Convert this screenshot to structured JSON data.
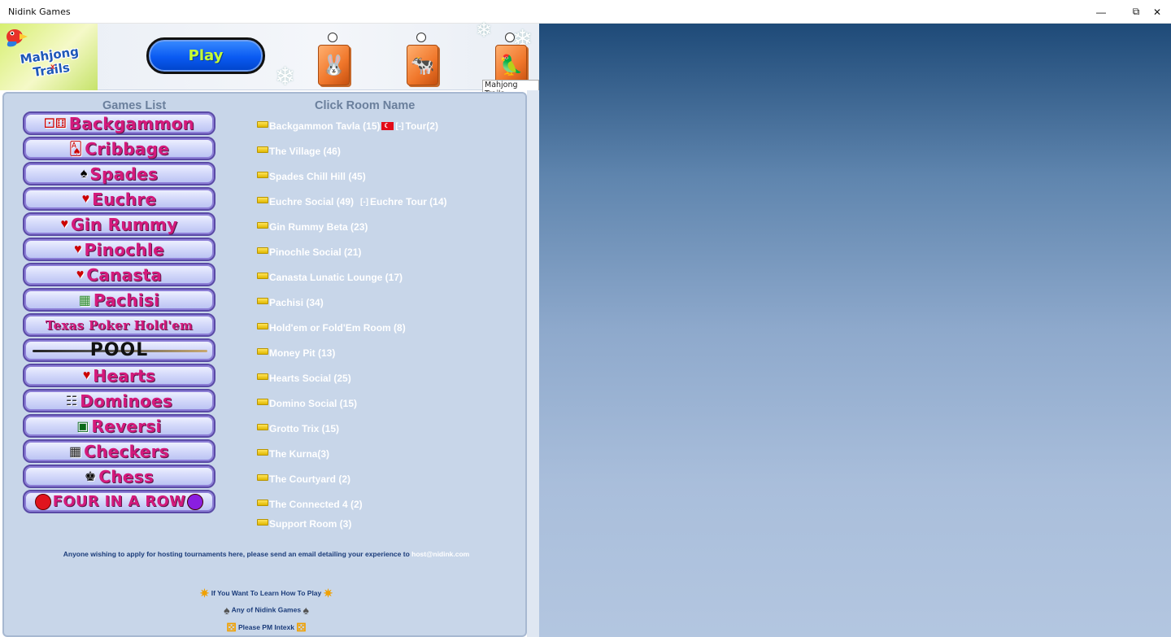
{
  "window": {
    "title": "Nidink Games",
    "minimize_glyph": "—",
    "maximize_glyph": "⧉",
    "close_glyph": "✕"
  },
  "banner": {
    "logo_text": "Mahjong Trails",
    "logo_mark": "x",
    "play_label": "Play",
    "snow_glyph": "❄",
    "tiles": [
      {
        "icon": "rabbit-icon",
        "glyph": "🐰"
      },
      {
        "icon": "cow-icon",
        "glyph": "🐄"
      },
      {
        "icon": "parrot-icon",
        "glyph": "🦜"
      }
    ],
    "tile_caption": "Mahjong Trails"
  },
  "panel": {
    "games_header": "Games List",
    "rooms_header": "Click Room Name",
    "games": [
      {
        "label": "Backgammon",
        "icon": "dice-icon",
        "glyph": "⚀⚅"
      },
      {
        "label": "Cribbage",
        "icon": "cards-icon",
        "glyph": "🂡"
      },
      {
        "label": "Spades",
        "icon": "cards-icon",
        "glyph": "♠"
      },
      {
        "label": "Euchre",
        "icon": "cards-icon",
        "glyph": "♥"
      },
      {
        "label": "Gin Rummy",
        "icon": "cards-icon",
        "glyph": "♥"
      },
      {
        "label": "Pinochle",
        "icon": "cards-icon",
        "glyph": "♥"
      },
      {
        "label": "Canasta",
        "icon": "cards-icon",
        "glyph": "♥"
      },
      {
        "label": "Pachisi",
        "icon": "board-icon",
        "glyph": "▦"
      },
      {
        "label": "Texas Poker Hold'em",
        "icon": "cards-icon",
        "glyph": ""
      },
      {
        "label": "POOL",
        "icon": "cue-icon",
        "glyph": ""
      },
      {
        "label": "Hearts",
        "icon": "cards-icon",
        "glyph": "♥"
      },
      {
        "label": "Dominoes",
        "icon": "domino-icon",
        "glyph": "☷"
      },
      {
        "label": "Reversi",
        "icon": "reversi-icon",
        "glyph": "▣"
      },
      {
        "label": "Checkers",
        "icon": "checkerboard-icon",
        "glyph": "▦"
      },
      {
        "label": "Chess",
        "icon": "chess-icon",
        "glyph": "♚"
      },
      {
        "label": "FOUR IN A ROW",
        "icon": "disc-icon",
        "glyph": ""
      }
    ],
    "rooms": [
      {
        "label": "Backgammon Tavla (15)",
        "extra": "Tour(2)"
      },
      {
        "label": "The Village (46)"
      },
      {
        "label": "Spades Chill Hill (45)"
      },
      {
        "label": "Euchre Social (49)",
        "extra": "Euchre Tour (14)"
      },
      {
        "label": "Gin Rummy Beta (23)"
      },
      {
        "label": "Pinochle Social (21)"
      },
      {
        "label": "Canasta Lunatic Lounge (17)"
      },
      {
        "label": "Pachisi (34)"
      },
      {
        "label": "Hold'em or Fold'Em Room (8)"
      },
      {
        "label": "Money Pit (13)"
      },
      {
        "label": "Hearts Social (25)"
      },
      {
        "label": "Domino Social (15)"
      },
      {
        "label": "Grotto Trix (15)"
      },
      {
        "label": "The Kurna(3)"
      },
      {
        "label": "The Courtyard (2)"
      },
      {
        "label": "The Connected 4 (2)"
      },
      {
        "label": "Support Room (3)"
      }
    ],
    "separator": "[-]",
    "note_text": "Anyone wishing to apply for hosting tournaments here, please send an email detailing your experience to",
    "note_email": "host@nidink.com",
    "learn_lines": [
      "If You Want To Learn How To Play",
      "Any of Nidink Games",
      "Please PM Intexk"
    ]
  }
}
